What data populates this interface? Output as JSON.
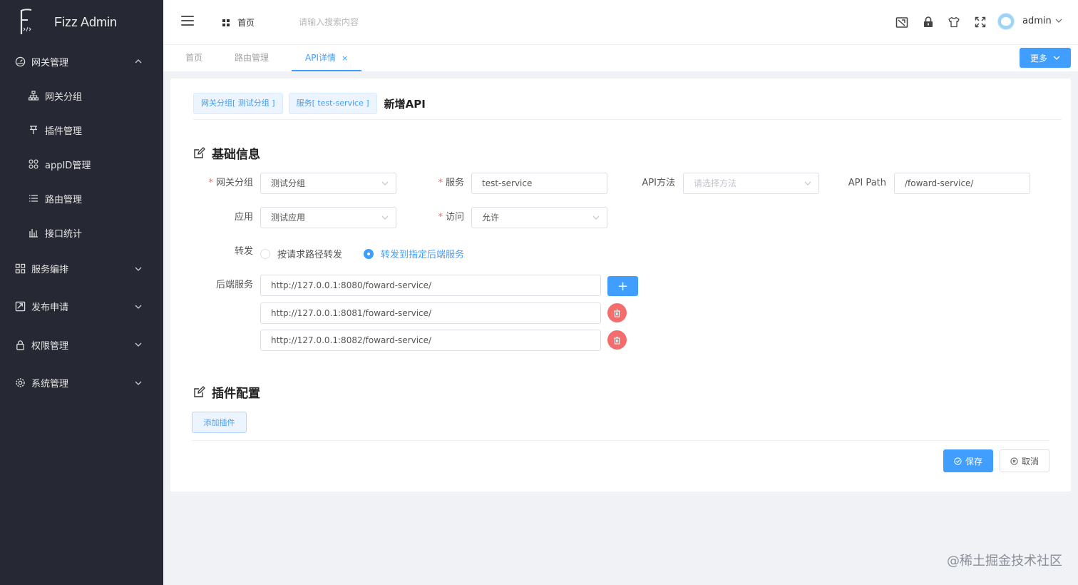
{
  "app": {
    "title": "Fizz Admin"
  },
  "sidebar": {
    "groups": [
      {
        "label": "网关管理",
        "icon": "dashboard-icon",
        "expanded": true,
        "items": [
          {
            "label": "网关分组",
            "icon": "sitemap-icon"
          },
          {
            "label": "插件管理",
            "icon": "pin-icon"
          },
          {
            "label": "appID管理",
            "icon": "apps-icon"
          },
          {
            "label": "路由管理",
            "icon": "list-icon"
          },
          {
            "label": "接口统计",
            "icon": "stats-icon"
          }
        ]
      },
      {
        "label": "服务编排",
        "icon": "grid-icon",
        "expanded": false
      },
      {
        "label": "发布申请",
        "icon": "publish-icon",
        "expanded": false
      },
      {
        "label": "权限管理",
        "icon": "lock-icon",
        "expanded": false
      },
      {
        "label": "系统管理",
        "icon": "gear-icon",
        "expanded": false
      }
    ]
  },
  "header": {
    "breadcrumb_home": "首页",
    "search_placeholder": "请输入搜索内容",
    "user": "admin"
  },
  "tabs": [
    {
      "label": "首页",
      "active": false
    },
    {
      "label": "路由管理",
      "active": false
    },
    {
      "label": "API详情",
      "active": true,
      "close": "×"
    }
  ],
  "more_button": "更多",
  "page": {
    "crumb_group": "网关分组[ 测试分组 ]",
    "crumb_service": "服务[ test-service ]",
    "title": "新增API",
    "basic_section": "基础信息",
    "plugin_section": "插件配置",
    "form": {
      "group_label": "网关分组",
      "group_value": "测试分组",
      "service_label": "服务",
      "service_value": "test-service",
      "method_label": "API方法",
      "method_placeholder": "请选择方法",
      "path_label": "API Path",
      "path_value": "/foward-service/",
      "app_label": "应用",
      "app_value": "测试应用",
      "access_label": "访问",
      "access_value": "允许",
      "forward_label": "转发",
      "forward_option_1": "按请求路径转发",
      "forward_option_2": "转发到指定后端服务",
      "backend_label": "后端服务",
      "backends": [
        "http://127.0.0.1:8080/foward-service/",
        "http://127.0.0.1:8081/foward-service/",
        "http://127.0.0.1:8082/foward-service/"
      ],
      "add_symbol": "+"
    },
    "add_plugin": "添加插件",
    "save": "保存",
    "cancel": "取消"
  },
  "watermark": "@稀土掘金技术社区",
  "colors": {
    "primary": "#409eff",
    "sidebar": "#262933",
    "danger": "#f56c6c"
  }
}
